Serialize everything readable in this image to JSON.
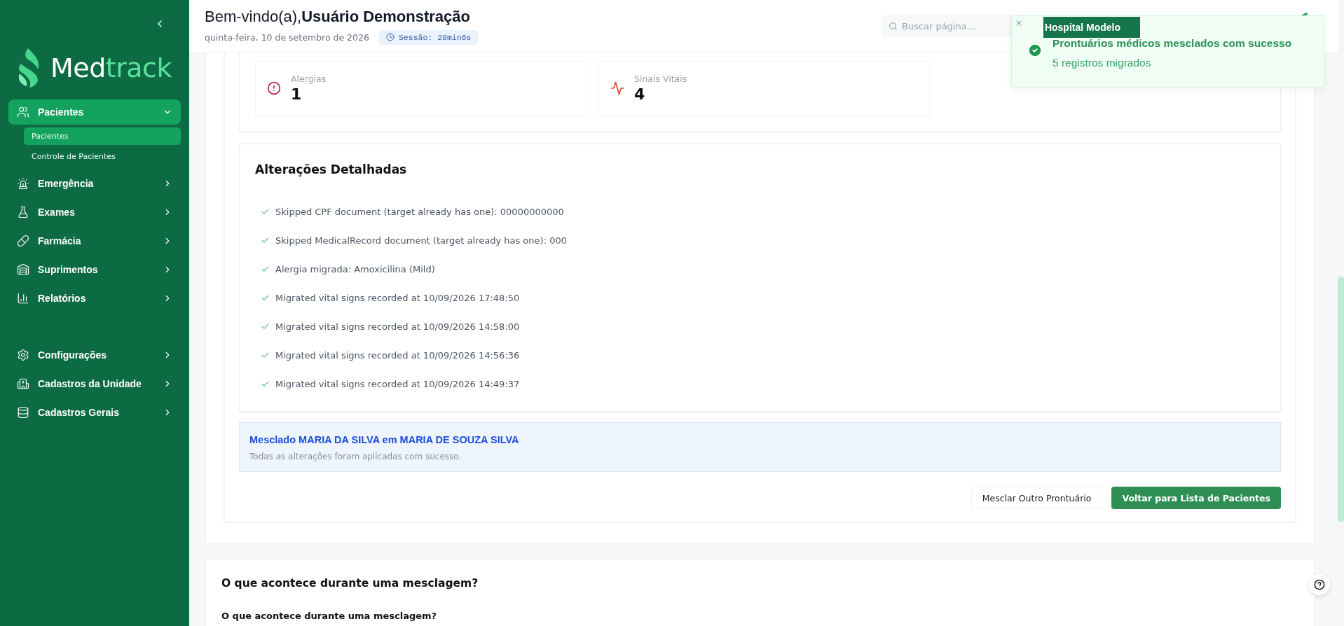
{
  "sidebar": {
    "logo": {
      "prefix": "Med",
      "suffix": "track"
    },
    "groups": [
      {
        "items": [
          {
            "label": "Pacientes",
            "expanded": true,
            "selected": true,
            "children": [
              {
                "label": "Pacientes",
                "selected": true
              },
              {
                "label": "Controle de Pacientes",
                "selected": false
              }
            ]
          },
          {
            "label": "Emergência",
            "expanded": false,
            "selected": false
          },
          {
            "label": "Exames",
            "expanded": false,
            "selected": false
          },
          {
            "label": "Farmácia",
            "expanded": false,
            "selected": false
          },
          {
            "label": "Suprimentos",
            "expanded": false,
            "selected": false
          },
          {
            "label": "Relatórios",
            "expanded": false,
            "selected": false
          }
        ]
      },
      {
        "items": [
          {
            "label": "Configurações",
            "expanded": false,
            "selected": false
          },
          {
            "label": "Cadastros da Unidade",
            "expanded": false,
            "selected": false
          },
          {
            "label": "Cadastros Gerais",
            "expanded": false,
            "selected": false
          }
        ]
      }
    ]
  },
  "header": {
    "greeting": "Bem-vindo(a),",
    "user": "Usuário Demonstração",
    "date": "quinta-feira, 10 de setembro de 2026",
    "session": "Sessão: 29min6s",
    "search": {
      "placeholder": "Buscar página..."
    },
    "unit": "Hospital Modelo"
  },
  "toast": {
    "title": "Prontuários médicos mesclados com sucesso",
    "message": "5 registros migrados"
  },
  "stats": [
    {
      "label": "Alergias",
      "value": "1"
    },
    {
      "label": "Sinais Vitais",
      "value": "4"
    }
  ],
  "changes": {
    "title": "Alterações Detalhadas",
    "items": [
      "Skipped CPF document (target already has one): 00000000000",
      "Skipped MedicalRecord document (target already has one): 000",
      "Alergia migrada: Amoxicilina (Mild)",
      "Migrated vital signs recorded at 10/09/2026 17:48:50",
      "Migrated vital signs recorded at 10/09/2026 14:58:00",
      "Migrated vital signs recorded at 10/09/2026 14:56:36",
      "Migrated vital signs recorded at 10/09/2026 14:49:37"
    ]
  },
  "result": {
    "title": "Mesclado MARIA DA SILVA em MARIA DE SOUZA SILVA",
    "message": "Todas as alterações foram aplicadas com sucesso."
  },
  "buttons": [
    {
      "label": "Mesclar Outro Prontuário",
      "kind": "secondary"
    },
    {
      "label": "Voltar para Lista de Pacientes",
      "kind": "primary"
    }
  ],
  "info": {
    "title": "O que acontece durante uma mesclagem?",
    "subtitle": "O que acontece durante uma mesclagem?"
  }
}
